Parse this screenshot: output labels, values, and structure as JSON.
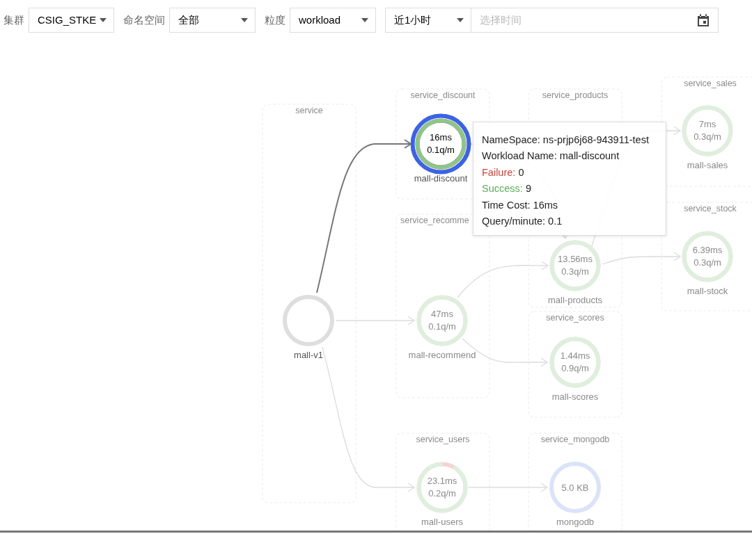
{
  "filters": [
    {
      "label": "集群",
      "value": "CSIG_STKE"
    },
    {
      "label": "命名空间",
      "value": "全部"
    },
    {
      "label": "粒度",
      "value": "workload"
    }
  ],
  "time_range": {
    "value": "近1小时",
    "placeholder": "选择时间"
  },
  "graph": {
    "groups": [
      {
        "title": "service",
        "nodes": [
          {
            "name": "mall-v1",
            "kind": "source",
            "dimmed": false,
            "selected": false
          }
        ]
      },
      {
        "title": "service_discount",
        "nodes": [
          {
            "name": "mall-discount",
            "kind": "service",
            "latency": "16ms",
            "qpm": "0.1q/m",
            "level": 1,
            "dimmed": false,
            "selected": true
          }
        ]
      },
      {
        "title": "service_products",
        "nodes": [
          {
            "name": "mall-products",
            "kind": "service",
            "latency": "13.56ms",
            "qpm": "0.3q/m",
            "level": 1,
            "dimmed": true,
            "selected": false
          }
        ]
      },
      {
        "title": "service_sales",
        "nodes": [
          {
            "name": "mall-sales",
            "kind": "service",
            "latency": "7ms",
            "qpm": "0.3q/m",
            "level": 1,
            "dimmed": true,
            "selected": false
          }
        ]
      },
      {
        "title": "service_stock",
        "nodes": [
          {
            "name": "mall-stock",
            "kind": "service",
            "latency": "6.39ms",
            "qpm": "0.3q/m",
            "level": 1,
            "dimmed": true,
            "selected": false
          }
        ]
      },
      {
        "title": "service_recomme",
        "nodes": [
          {
            "name": "mall-recommend",
            "kind": "service",
            "latency": "47ms",
            "qpm": "0.1q/m",
            "level": 1,
            "dimmed": true,
            "selected": false
          }
        ]
      },
      {
        "title": "service_scores",
        "nodes": [
          {
            "name": "mall-scores",
            "kind": "service",
            "latency": "1.44ms",
            "qpm": "0.9q/m",
            "level": 1,
            "dimmed": true,
            "selected": false
          }
        ]
      },
      {
        "title": "service_users",
        "nodes": [
          {
            "name": "mall-users",
            "kind": "service",
            "latency": "23.1ms",
            "qpm": "0.2q/m",
            "level": 0.92,
            "dimmed": true,
            "selected": false
          }
        ]
      },
      {
        "title": "service_mongodb",
        "nodes": [
          {
            "name": "mongodb",
            "kind": "database",
            "latency": "5.0 KB",
            "dimmed": true,
            "selected": false
          }
        ]
      }
    ],
    "edges": [
      {
        "highlighted": true
      },
      {
        "highlighted": false
      },
      {
        "highlighted": false
      },
      {
        "highlighted": false
      },
      {
        "highlighted": false
      },
      {
        "highlighted": false
      },
      {
        "highlighted": false
      },
      {
        "highlighted": false
      },
      {
        "highlighted": false
      }
    ]
  },
  "tooltip": {
    "rows": [
      {
        "label": "NameSpace:",
        "value": "ns-prjp6j68-943911-test",
        "kind": "plain"
      },
      {
        "label": "Workload Name:",
        "value": "mall-discount",
        "kind": "plain"
      },
      {
        "label": "Failure:",
        "value": "0",
        "kind": "failure"
      },
      {
        "label": "Success:",
        "value": "9",
        "kind": "success"
      },
      {
        "label": "Time Cost:",
        "value": "16ms",
        "kind": "plain"
      },
      {
        "label": "Query/minute:",
        "value": "0.1",
        "kind": "plain"
      }
    ]
  }
}
